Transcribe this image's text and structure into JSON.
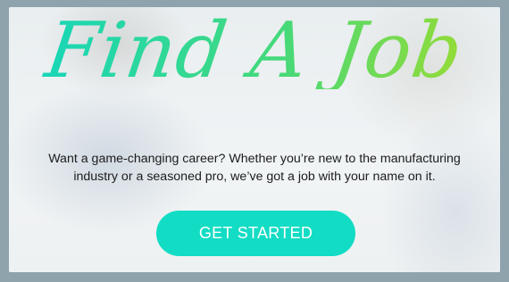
{
  "hero": {
    "headline": "Find A Job",
    "description": "Want a game-changing career? Whether you’re new to the manufacturing industry or a seasoned pro, we’ve got a job with your name on it.",
    "cta_label": "GET STARTED"
  },
  "colors": {
    "accent_teal": "#12dcc4",
    "accent_green": "#a4dc2a",
    "frame_border": "#8fa3ad",
    "text": "#1c1c1c"
  }
}
